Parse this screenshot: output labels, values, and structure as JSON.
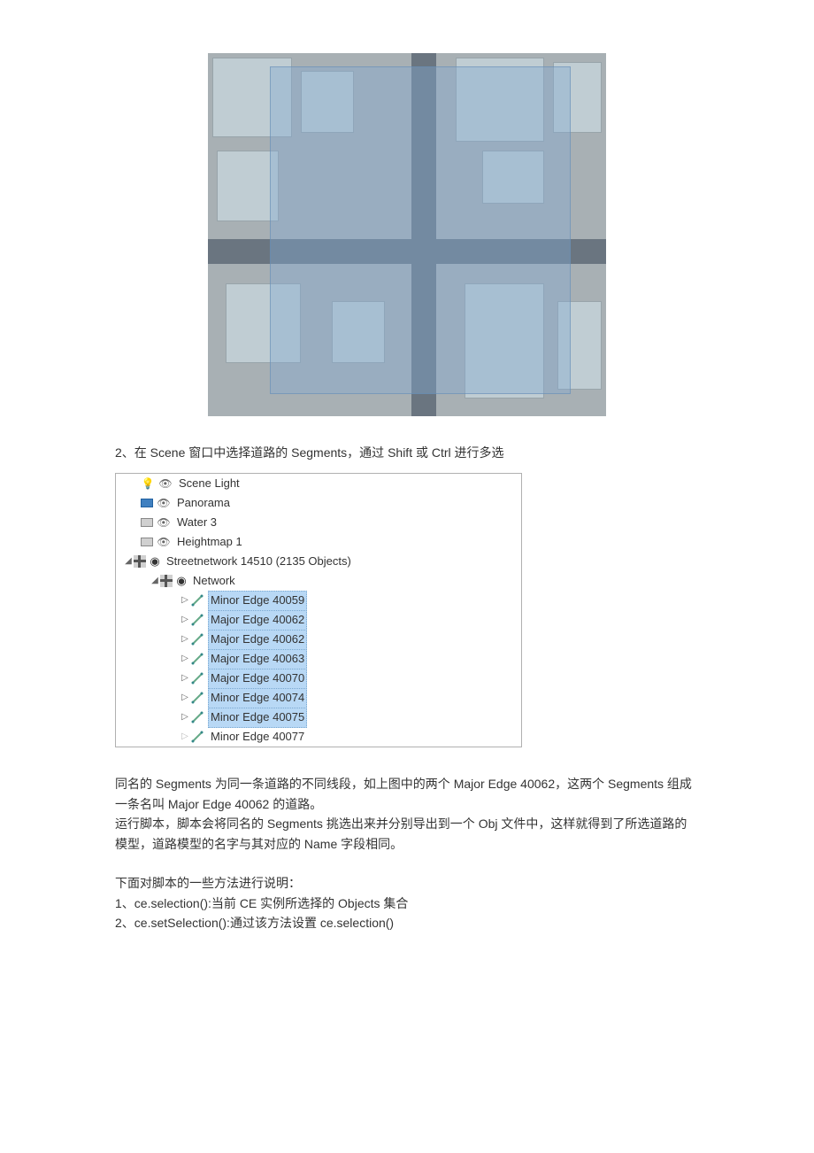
{
  "step2": "2、在 Scene 窗口中选择道路的 Segments，通过 Shift 或 Ctrl 进行多选",
  "tree": {
    "sceneLight": "Scene Light",
    "panorama": "Panorama",
    "water": "Water 3",
    "heightmap": "Heightmap 1",
    "streetnetwork": "Streetnetwork 14510 (2135 Objects)",
    "network": "Network",
    "edges": [
      {
        "label": "Minor Edge 40059",
        "selected": true
      },
      {
        "label": "Major Edge 40062",
        "selected": true
      },
      {
        "label": "Major Edge 40062",
        "selected": true
      },
      {
        "label": "Major Edge 40063",
        "selected": true
      },
      {
        "label": "Major Edge 40070",
        "selected": true
      },
      {
        "label": "Minor Edge 40074",
        "selected": true
      },
      {
        "label": "Minor Edge 40075",
        "selected": true
      },
      {
        "label": "Minor Edge 40077",
        "selected": false
      }
    ]
  },
  "para1": "同名的 Segments 为同一条道路的不同线段，如上图中的两个 Major Edge 40062，这两个 Segments 组成一条名叫 Major Edge 40062 的道路。",
  "para2": "运行脚本，脚本会将同名的 Segments 挑选出来并分别导出到一个 Obj 文件中，这样就得到了所选道路的模型，道路模型的名字与其对应的 Name 字段相同。",
  "para3": "下面对脚本的一些方法进行说明：",
  "method1": "1、ce.selection():当前 CE 实例所选择的 Objects 集合",
  "method2": "2、ce.setSelection():通过该方法设置 ce.selection()"
}
